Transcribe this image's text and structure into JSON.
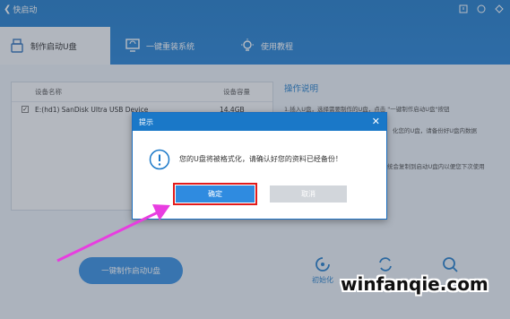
{
  "app": {
    "title": "快启动"
  },
  "nav": [
    {
      "label": "制作启动U盘",
      "icon": "usb-drive-icon"
    },
    {
      "label": "一键重装系统",
      "icon": "reinstall-icon"
    },
    {
      "label": "使用教程",
      "icon": "bulb-icon"
    }
  ],
  "device_table": {
    "headers": {
      "name": "设备名称",
      "size": "设备容量"
    },
    "rows": [
      {
        "name": "E:(hd1) SanDisk Ultra USB Device",
        "size": "14.4GB",
        "checked": true
      }
    ]
  },
  "instructions": {
    "title": "操作说明",
    "lines": [
      "1.插入U盘，选择需要制作的U盘，点击 \"一键制作启动U盘\"按钮",
      "化您的U盘，请备份好U盘内数据",
      "统会复制到启动U盘内以便您下次使用"
    ]
  },
  "main_button": "一键制作启动U盘",
  "tools": [
    {
      "label": "初始化"
    },
    {
      "label": ""
    },
    {
      "label": ""
    }
  ],
  "dialog": {
    "title": "提示",
    "message": "您的U盘将被格式化，请确认好您的资料已经备份！",
    "ok": "确定",
    "cancel": "取消"
  },
  "watermark": "winfanqie.com",
  "colors": {
    "primary": "#1a78c8",
    "button": "#2f8be0",
    "highlight": "#e21b1b",
    "arrow": "#e83de0"
  }
}
